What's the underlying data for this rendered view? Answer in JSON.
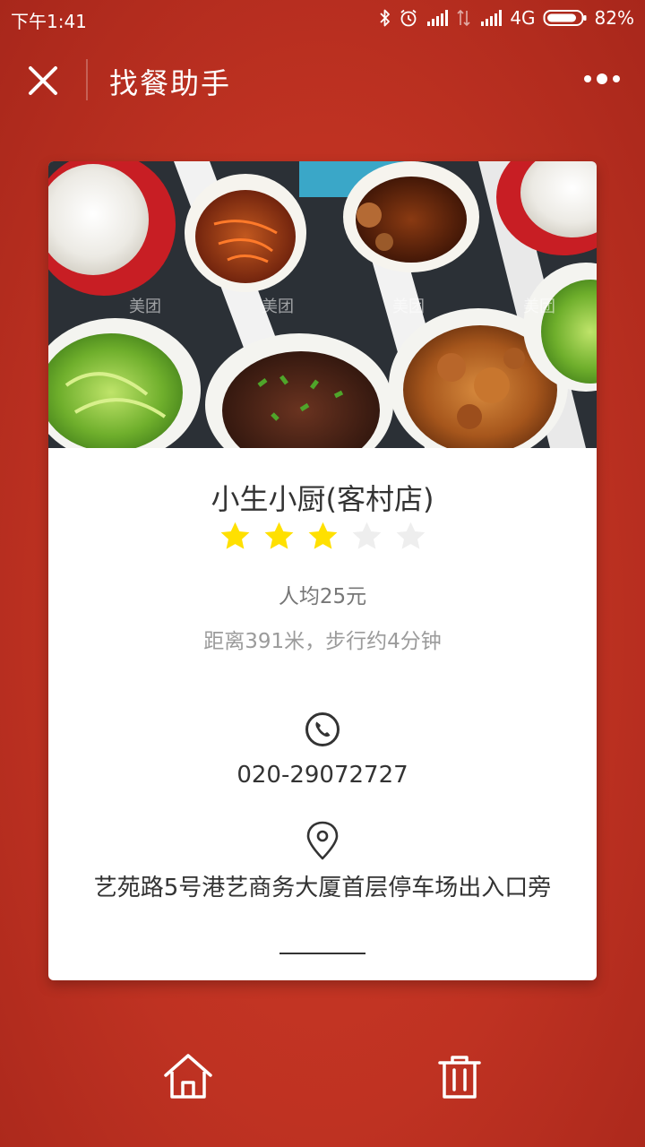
{
  "status_bar": {
    "time": "下午1:41",
    "network": "4G",
    "battery": "82%"
  },
  "nav": {
    "title": "找餐助手",
    "close_icon": "close-icon",
    "more_icon": "more-dots-icon"
  },
  "restaurant": {
    "name": "小生小厨(客村店)",
    "rating": 3,
    "rating_max": 5,
    "avg_price": "人均25元",
    "distance": "距离391米，步行约4分钟",
    "phone": "020-29072727",
    "address": "艺苑路5号港艺商务大厦首层停车场出入口旁"
  },
  "colors": {
    "background": "#c0311f",
    "star_filled": "#ffe000",
    "star_empty": "#eeeeee",
    "text_primary": "#333333",
    "text_secondary": "#9b9b9b"
  },
  "bottom_bar": {
    "home_icon": "home-icon",
    "trash_icon": "trash-icon"
  }
}
